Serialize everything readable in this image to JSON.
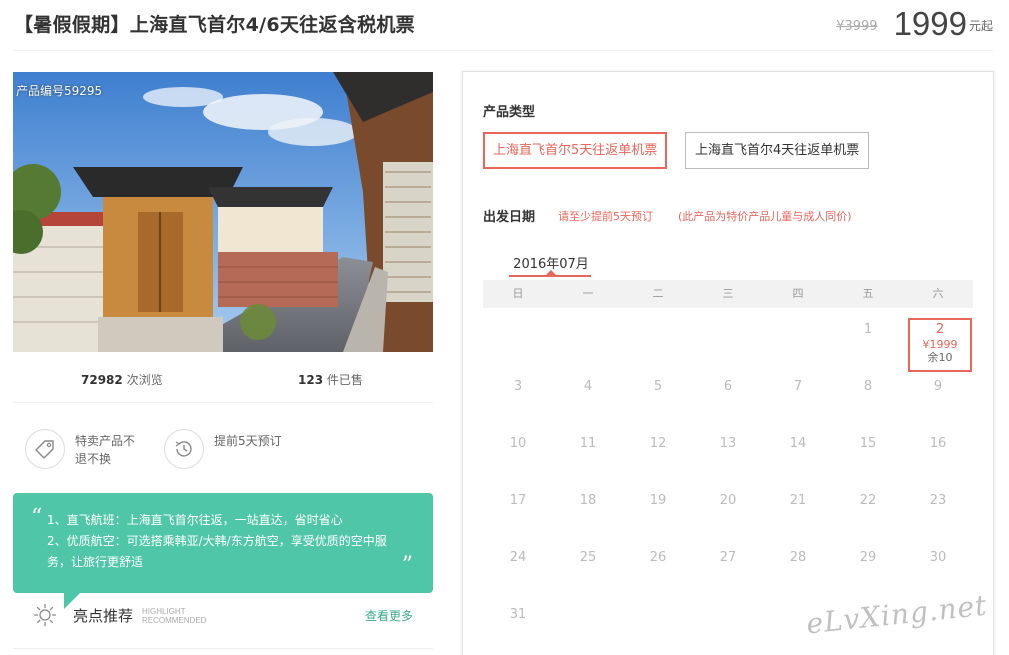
{
  "header": {
    "title": "【暑假假期】上海直飞首尔4/6天往返含税机票",
    "original_price": "¥3999",
    "current_price": "1999",
    "price_suffix": "元起"
  },
  "photo": {
    "product_code": "产品编号59295"
  },
  "stats": {
    "views_number": "72982",
    "views_label": "次浏览",
    "sold_number": "123",
    "sold_label": "件已售"
  },
  "features": [
    {
      "icon": "tag-icon",
      "text": "特卖产品不退不换"
    },
    {
      "icon": "clock-icon",
      "text": "提前5天预订"
    }
  ],
  "highlight_quote": {
    "open_mark": "“",
    "close_mark": "”",
    "lines": [
      "1、直飞航班：上海直飞首尔往返，一站直达，省时省心",
      "2、优质航空：可选搭乘韩亚/大韩/东方航空，享受优质的空中服务，让旅行更舒适"
    ]
  },
  "highlight_section": {
    "title": "亮点推荐",
    "subtitle_en_1": "HIGHLIGHT",
    "subtitle_en_2": "RECOMMENDED",
    "more_link": "查看更多"
  },
  "booking": {
    "product_type_label": "产品类型",
    "product_types": [
      {
        "label": "上海直飞首尔5天往返单机票",
        "selected": true
      },
      {
        "label": "上海直飞首尔4天往返单机票",
        "selected": false
      }
    ],
    "departure_label": "出发日期",
    "notice_advance": "请至少提前5天预订",
    "notice_child": "(此产品为特价产品儿童与成人同价)",
    "month_tab": "2016年07月",
    "weekdays": [
      "日",
      "一",
      "二",
      "三",
      "四",
      "五",
      "六"
    ],
    "weeks": [
      [
        "",
        "",
        "",
        "",
        "",
        "1",
        "2"
      ],
      [
        "3",
        "4",
        "5",
        "6",
        "7",
        "8",
        "9"
      ],
      [
        "10",
        "11",
        "12",
        "13",
        "14",
        "15",
        "16"
      ],
      [
        "17",
        "18",
        "19",
        "20",
        "21",
        "22",
        "23"
      ],
      [
        "24",
        "25",
        "26",
        "27",
        "28",
        "29",
        "30"
      ],
      [
        "31",
        "",
        "",
        "",
        "",
        "",
        ""
      ]
    ],
    "selected_date": {
      "day": "2",
      "price": "¥1999",
      "stock": "余10"
    }
  },
  "watermark": "eLvXing.net",
  "colors": {
    "accent_red": "#e8665a",
    "quote_green": "#4ec6a7",
    "link_green": "#3aab87"
  }
}
